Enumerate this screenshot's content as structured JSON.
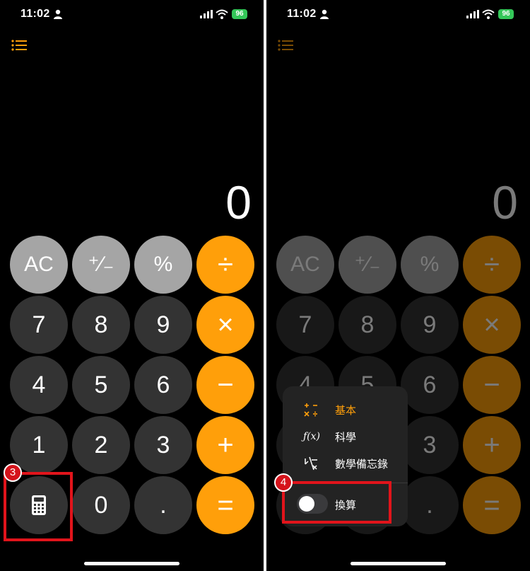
{
  "status_bar": {
    "time": "11:02",
    "battery": "96"
  },
  "display": {
    "value": "0"
  },
  "keys": {
    "ac": "AC",
    "plus_minus": "⁺∕₋",
    "percent": "%",
    "divide": "÷",
    "seven": "7",
    "eight": "8",
    "nine": "9",
    "multiply": "×",
    "four": "4",
    "five": "5",
    "six": "6",
    "minus": "−",
    "one": "1",
    "two": "2",
    "three": "3",
    "plus": "+",
    "zero": "0",
    "decimal": ".",
    "equals": "="
  },
  "menu": {
    "items": [
      {
        "label": "基本",
        "icon": "basic-calculator-icon",
        "active": true
      },
      {
        "label": "科學",
        "icon": "function-icon",
        "active": false
      },
      {
        "label": "數學備忘錄",
        "icon": "math-notes-icon",
        "active": false
      }
    ],
    "convert": {
      "label": "換算",
      "enabled": false
    }
  },
  "annotations": {
    "step3": "3",
    "step4": "4"
  },
  "colors": {
    "orange": "#ff9f0a",
    "light_gray": "#a5a5a5",
    "dark_gray": "#333333",
    "callout_red": "#e1141b"
  }
}
